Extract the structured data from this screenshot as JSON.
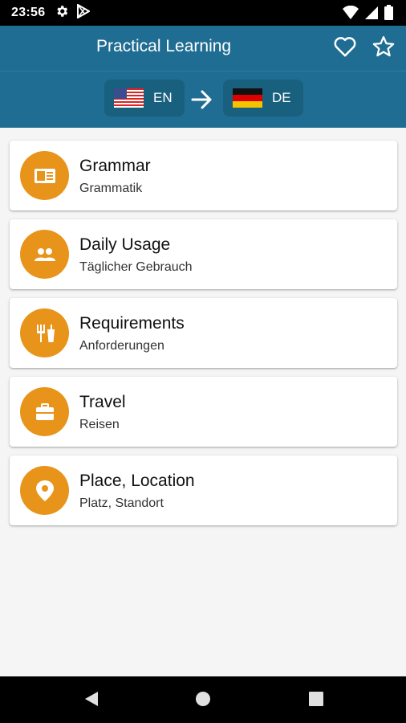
{
  "status_bar": {
    "time": "23:56",
    "icons": [
      "gear-icon",
      "play-store-icon",
      "wifi-icon",
      "signal-icon",
      "battery-icon"
    ]
  },
  "app_bar": {
    "title": "Practical Learning",
    "actions": [
      "favorite-icon",
      "star-icon"
    ]
  },
  "language": {
    "source": {
      "code": "EN",
      "flag": "us-flag-icon"
    },
    "target": {
      "code": "DE",
      "flag": "germany-flag-icon"
    }
  },
  "categories": [
    {
      "title": "Grammar",
      "subtitle": "Grammatik",
      "icon": "book-icon"
    },
    {
      "title": "Daily Usage",
      "subtitle": "Täglicher Gebrauch",
      "icon": "people-icon"
    },
    {
      "title": "Requirements",
      "subtitle": "Anforderungen",
      "icon": "food-icon"
    },
    {
      "title": "Travel",
      "subtitle": "Reisen",
      "icon": "suitcase-icon"
    },
    {
      "title": "Place, Location",
      "subtitle": "Platz, Standort",
      "icon": "location-pin-icon"
    }
  ],
  "colors": {
    "app_bar": "#1f6d92",
    "accent": "#e8941a",
    "background": "#f5f5f5"
  },
  "nav_bar": {
    "buttons": [
      "back-icon",
      "home-icon",
      "recents-icon"
    ]
  }
}
